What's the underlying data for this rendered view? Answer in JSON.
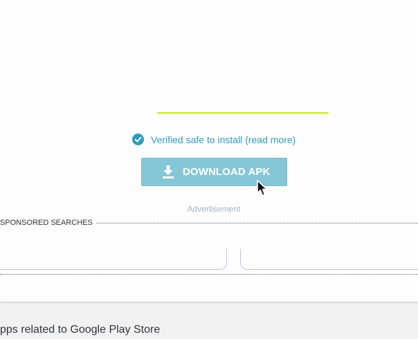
{
  "verified": {
    "text": "Verified safe to install",
    "link": "(read more)",
    "icon": "check-circle-icon",
    "color": "#2f9bbd"
  },
  "download": {
    "label": "DOWNLOAD APK",
    "icon": "download-icon",
    "color": "#85c6d7"
  },
  "ad_label": "Advertisement",
  "sponsored": {
    "title": "SPONSORED SEARCHES"
  },
  "related": {
    "title": "pps related to Google Play Store"
  },
  "cursor": {
    "icon": "mouse-pointer-icon"
  },
  "colors": {
    "progress": "#d7ea5c",
    "page_background": "#f1f1f1",
    "card_background": "#fdfdfd"
  }
}
